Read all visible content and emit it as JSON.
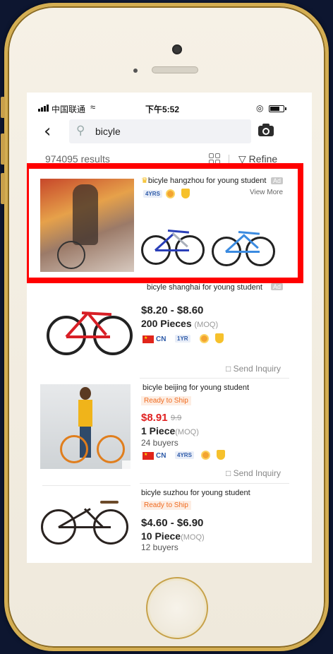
{
  "status_bar": {
    "carrier": "中国联通",
    "time": "下午5:52"
  },
  "search": {
    "query": "bicyle"
  },
  "results": {
    "count_text": "974095 results",
    "refine_label": "Refine"
  },
  "ad": {
    "title": "bicyle hangzhou for young student",
    "tag": "Ad",
    "years": "4YRS",
    "view_more": "View More"
  },
  "items": [
    {
      "title": "bicyle shanghai for young student",
      "tag": "Ad",
      "price": "$8.20 - $8.60",
      "qty": "200 Pieces",
      "moq": "(MOQ)",
      "country": "CN",
      "years": "1YR",
      "inquiry": "Send Inquiry"
    },
    {
      "title": "bicyle beijing for young student",
      "ready": "Ready to Ship",
      "price": "$8.91",
      "old_price": "9.9",
      "qty": "1 Piece",
      "moq": "(MOQ)",
      "buyers": "24 buyers",
      "country": "CN",
      "years": "4YRS",
      "inquiry": "Send Inquiry"
    },
    {
      "title": "bicyle suzhou for young student",
      "ready": "Ready to Ship",
      "price": "$4.60 - $6.90",
      "qty": "10 Piece",
      "moq": "(MOQ)",
      "buyers": "12 buyers"
    }
  ],
  "colors": {
    "highlight_frame": "#ff0000",
    "price_red": "#e02020",
    "ready_orange": "#f06a1e",
    "phone_gold": "#d4ae52"
  }
}
